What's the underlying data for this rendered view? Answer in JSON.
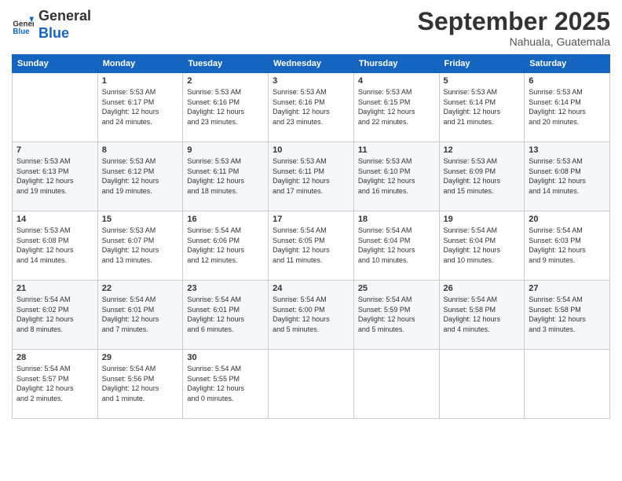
{
  "logo": {
    "general": "General",
    "blue": "Blue"
  },
  "title": "September 2025",
  "subtitle": "Nahuala, Guatemala",
  "days_header": [
    "Sunday",
    "Monday",
    "Tuesday",
    "Wednesday",
    "Thursday",
    "Friday",
    "Saturday"
  ],
  "weeks": [
    [
      {
        "day": "",
        "info": ""
      },
      {
        "day": "1",
        "info": "Sunrise: 5:53 AM\nSunset: 6:17 PM\nDaylight: 12 hours\nand 24 minutes."
      },
      {
        "day": "2",
        "info": "Sunrise: 5:53 AM\nSunset: 6:16 PM\nDaylight: 12 hours\nand 23 minutes."
      },
      {
        "day": "3",
        "info": "Sunrise: 5:53 AM\nSunset: 6:16 PM\nDaylight: 12 hours\nand 23 minutes."
      },
      {
        "day": "4",
        "info": "Sunrise: 5:53 AM\nSunset: 6:15 PM\nDaylight: 12 hours\nand 22 minutes."
      },
      {
        "day": "5",
        "info": "Sunrise: 5:53 AM\nSunset: 6:14 PM\nDaylight: 12 hours\nand 21 minutes."
      },
      {
        "day": "6",
        "info": "Sunrise: 5:53 AM\nSunset: 6:14 PM\nDaylight: 12 hours\nand 20 minutes."
      }
    ],
    [
      {
        "day": "7",
        "info": "Sunrise: 5:53 AM\nSunset: 6:13 PM\nDaylight: 12 hours\nand 19 minutes."
      },
      {
        "day": "8",
        "info": "Sunrise: 5:53 AM\nSunset: 6:12 PM\nDaylight: 12 hours\nand 19 minutes."
      },
      {
        "day": "9",
        "info": "Sunrise: 5:53 AM\nSunset: 6:11 PM\nDaylight: 12 hours\nand 18 minutes."
      },
      {
        "day": "10",
        "info": "Sunrise: 5:53 AM\nSunset: 6:11 PM\nDaylight: 12 hours\nand 17 minutes."
      },
      {
        "day": "11",
        "info": "Sunrise: 5:53 AM\nSunset: 6:10 PM\nDaylight: 12 hours\nand 16 minutes."
      },
      {
        "day": "12",
        "info": "Sunrise: 5:53 AM\nSunset: 6:09 PM\nDaylight: 12 hours\nand 15 minutes."
      },
      {
        "day": "13",
        "info": "Sunrise: 5:53 AM\nSunset: 6:08 PM\nDaylight: 12 hours\nand 14 minutes."
      }
    ],
    [
      {
        "day": "14",
        "info": "Sunrise: 5:53 AM\nSunset: 6:08 PM\nDaylight: 12 hours\nand 14 minutes."
      },
      {
        "day": "15",
        "info": "Sunrise: 5:53 AM\nSunset: 6:07 PM\nDaylight: 12 hours\nand 13 minutes."
      },
      {
        "day": "16",
        "info": "Sunrise: 5:54 AM\nSunset: 6:06 PM\nDaylight: 12 hours\nand 12 minutes."
      },
      {
        "day": "17",
        "info": "Sunrise: 5:54 AM\nSunset: 6:05 PM\nDaylight: 12 hours\nand 11 minutes."
      },
      {
        "day": "18",
        "info": "Sunrise: 5:54 AM\nSunset: 6:04 PM\nDaylight: 12 hours\nand 10 minutes."
      },
      {
        "day": "19",
        "info": "Sunrise: 5:54 AM\nSunset: 6:04 PM\nDaylight: 12 hours\nand 10 minutes."
      },
      {
        "day": "20",
        "info": "Sunrise: 5:54 AM\nSunset: 6:03 PM\nDaylight: 12 hours\nand 9 minutes."
      }
    ],
    [
      {
        "day": "21",
        "info": "Sunrise: 5:54 AM\nSunset: 6:02 PM\nDaylight: 12 hours\nand 8 minutes."
      },
      {
        "day": "22",
        "info": "Sunrise: 5:54 AM\nSunset: 6:01 PM\nDaylight: 12 hours\nand 7 minutes."
      },
      {
        "day": "23",
        "info": "Sunrise: 5:54 AM\nSunset: 6:01 PM\nDaylight: 12 hours\nand 6 minutes."
      },
      {
        "day": "24",
        "info": "Sunrise: 5:54 AM\nSunset: 6:00 PM\nDaylight: 12 hours\nand 5 minutes."
      },
      {
        "day": "25",
        "info": "Sunrise: 5:54 AM\nSunset: 5:59 PM\nDaylight: 12 hours\nand 5 minutes."
      },
      {
        "day": "26",
        "info": "Sunrise: 5:54 AM\nSunset: 5:58 PM\nDaylight: 12 hours\nand 4 minutes."
      },
      {
        "day": "27",
        "info": "Sunrise: 5:54 AM\nSunset: 5:58 PM\nDaylight: 12 hours\nand 3 minutes."
      }
    ],
    [
      {
        "day": "28",
        "info": "Sunrise: 5:54 AM\nSunset: 5:57 PM\nDaylight: 12 hours\nand 2 minutes."
      },
      {
        "day": "29",
        "info": "Sunrise: 5:54 AM\nSunset: 5:56 PM\nDaylight: 12 hours\nand 1 minute."
      },
      {
        "day": "30",
        "info": "Sunrise: 5:54 AM\nSunset: 5:55 PM\nDaylight: 12 hours\nand 0 minutes."
      },
      {
        "day": "",
        "info": ""
      },
      {
        "day": "",
        "info": ""
      },
      {
        "day": "",
        "info": ""
      },
      {
        "day": "",
        "info": ""
      }
    ]
  ]
}
